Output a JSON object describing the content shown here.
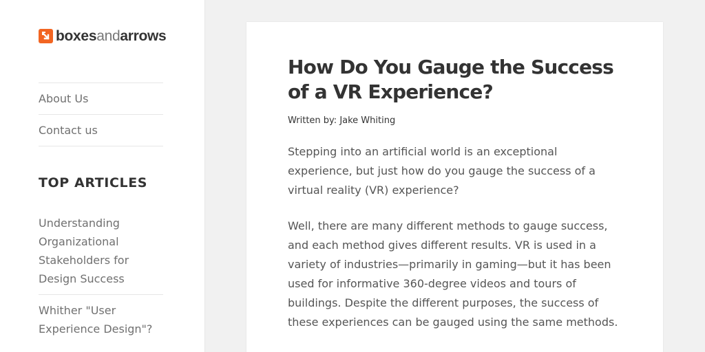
{
  "colors": {
    "brand_orange": "#f26522",
    "background": "#f1f1f1",
    "text_dark": "#333333",
    "text_muted": "#707070"
  },
  "sidebar": {
    "logo": {
      "icon": "boxes-arrow-logo-icon",
      "text_bold_1": "boxes",
      "text_light": "and",
      "text_bold_2": "arrows"
    },
    "nav": [
      {
        "label": "About Us"
      },
      {
        "label": "Contact us"
      }
    ],
    "top_articles": {
      "title": "TOP ARTICLES",
      "items": [
        {
          "label": "Understanding Organizational Stakeholders for Design Success"
        },
        {
          "label": "Whither \"User Experience Design\"?"
        }
      ]
    }
  },
  "article": {
    "title": "How Do You Gauge the Success of a VR Experience?",
    "byline_label": "Written by:",
    "author": "Jake Whiting",
    "paragraphs": [
      "Stepping into an artificial world is an exceptional experience, but just how do you gauge the success of a virtual reality (VR) experience?",
      "Well, there are many different methods to gauge success, and each method gives different results. VR is used in a variety of industries—primarily in gaming—but it has been used for informative 360-degree videos and tours of buildings. Despite the different purposes, the success of these experiences can be gauged using the same methods."
    ]
  }
}
